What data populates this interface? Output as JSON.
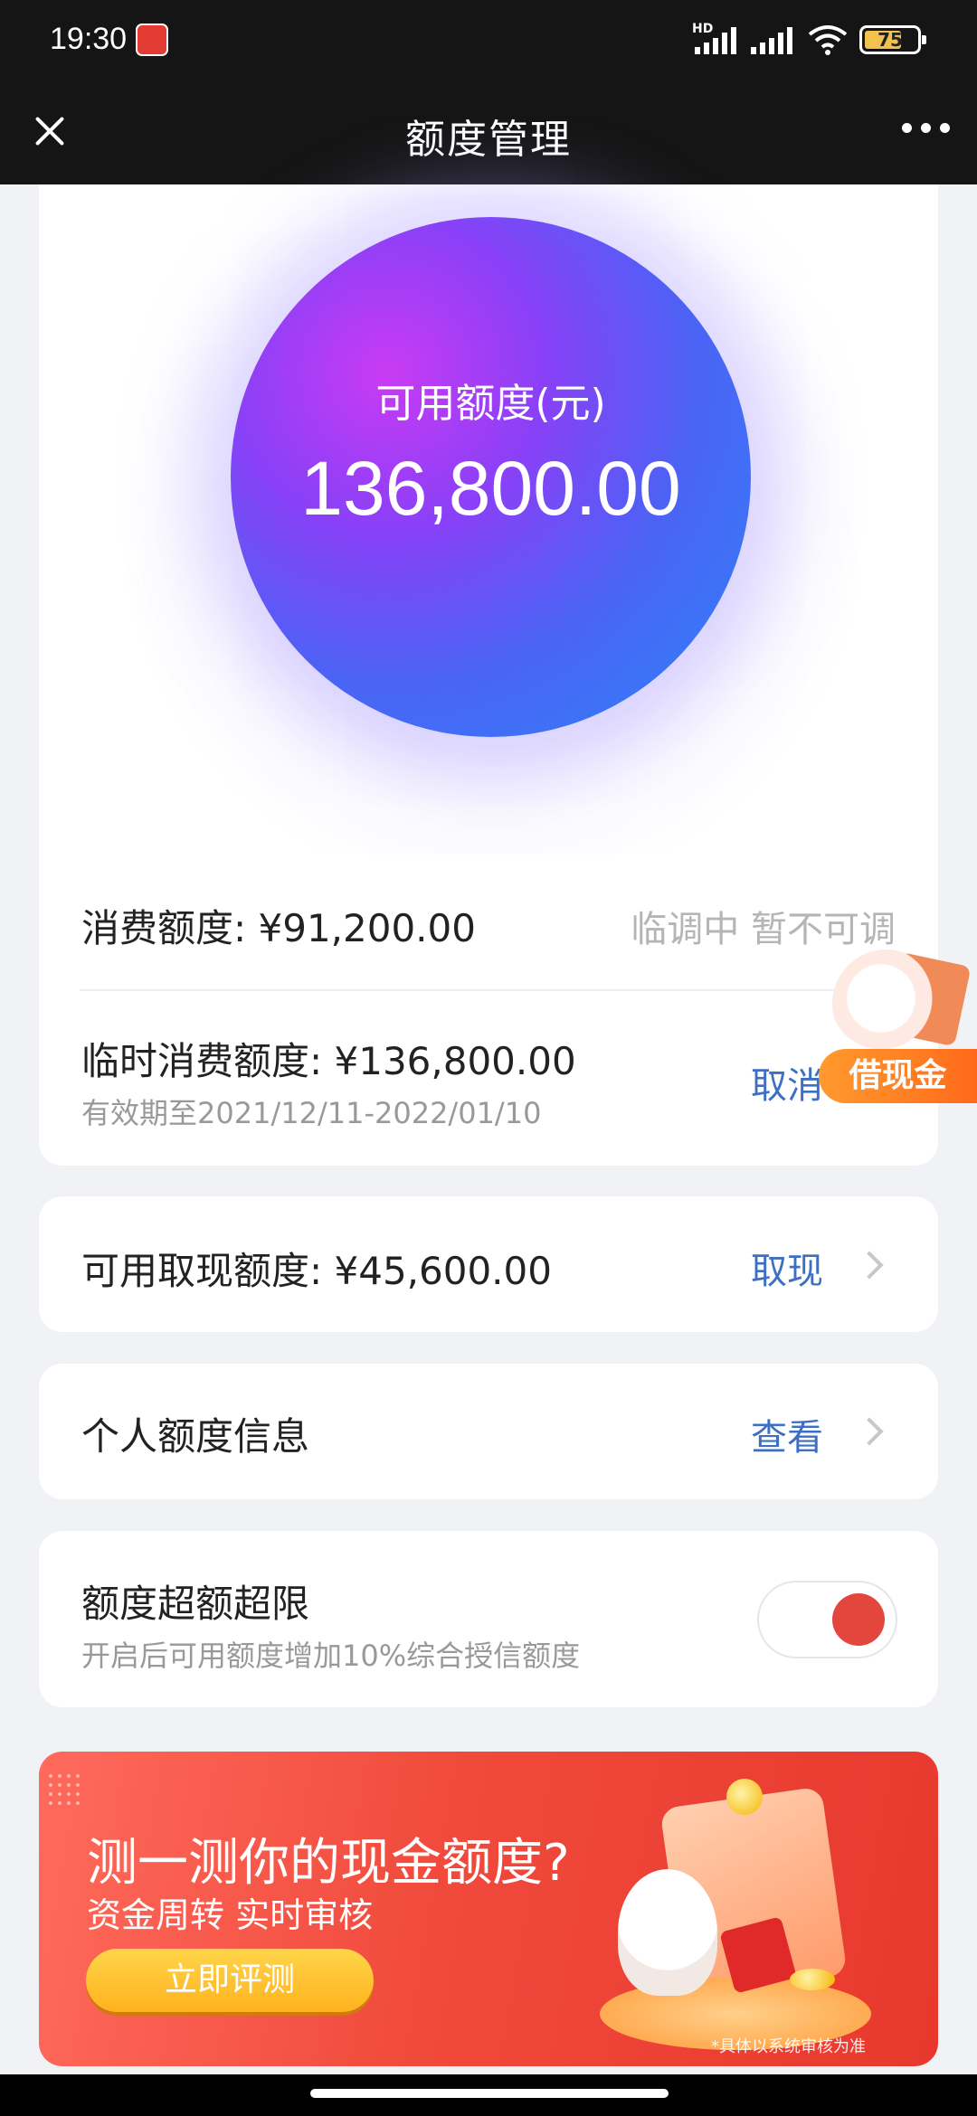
{
  "status_bar": {
    "time": "19:30",
    "network": "HD",
    "battery": "75"
  },
  "header": {
    "title": "额度管理"
  },
  "hero": {
    "label": "可用额度(元)",
    "value": "136,800.00"
  },
  "consumption": {
    "label": "消费额度: ¥91,200.00",
    "status": "临调中 暂不可调"
  },
  "temp_consumption": {
    "label": "临时消费额度: ¥136,800.00",
    "validity": "有效期至2021/12/11-2022/01/10",
    "action": "取消"
  },
  "float_badge": {
    "label": "借现金"
  },
  "cash": {
    "label": "可用取现额度: ¥45,600.00",
    "action": "取现"
  },
  "personal": {
    "label": "个人额度信息",
    "action": "查看"
  },
  "overlimit": {
    "label": "额度超额超限",
    "desc": "开启后可用额度增加10%综合授信额度",
    "toggle_on": true
  },
  "banner": {
    "title": "测一测你的现金额度?",
    "subtitle": "资金周转 实时审核",
    "button": "立即评测",
    "note": "*具体以系统审核为准"
  },
  "colors": {
    "accent_link": "#3d6fc2",
    "toggle_knob": "#e3463d",
    "banner_red": "#f04a3c"
  }
}
